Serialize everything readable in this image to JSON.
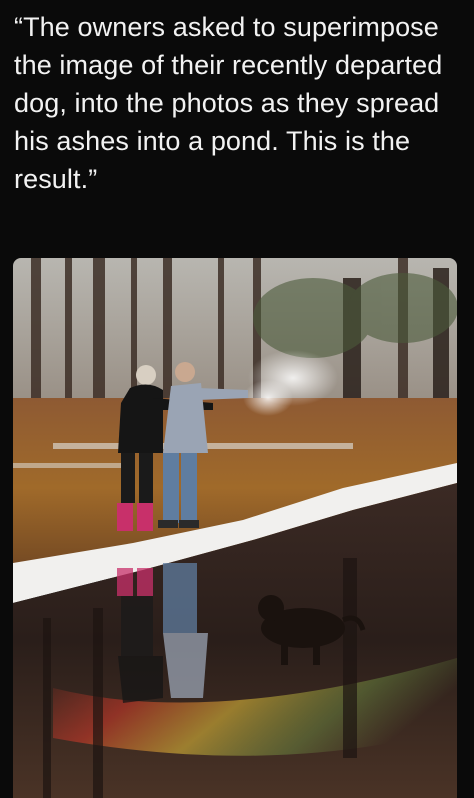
{
  "post": {
    "caption": "“The owners asked to superimpose the image of their recently departed dog, into the photos as they spread his ashes into a pond. This is the result.”"
  },
  "photo": {
    "subject": "memorial-pond-photo",
    "colors": {
      "background": "#0a0a0a",
      "caption_text": "#f2f2f2",
      "snow": "#f1f0ee",
      "water": "#2a1e1a",
      "leaves": "#9a5a25",
      "rainbow_red": "#d63a2a",
      "rainbow_yellow": "#e8c23a"
    }
  }
}
